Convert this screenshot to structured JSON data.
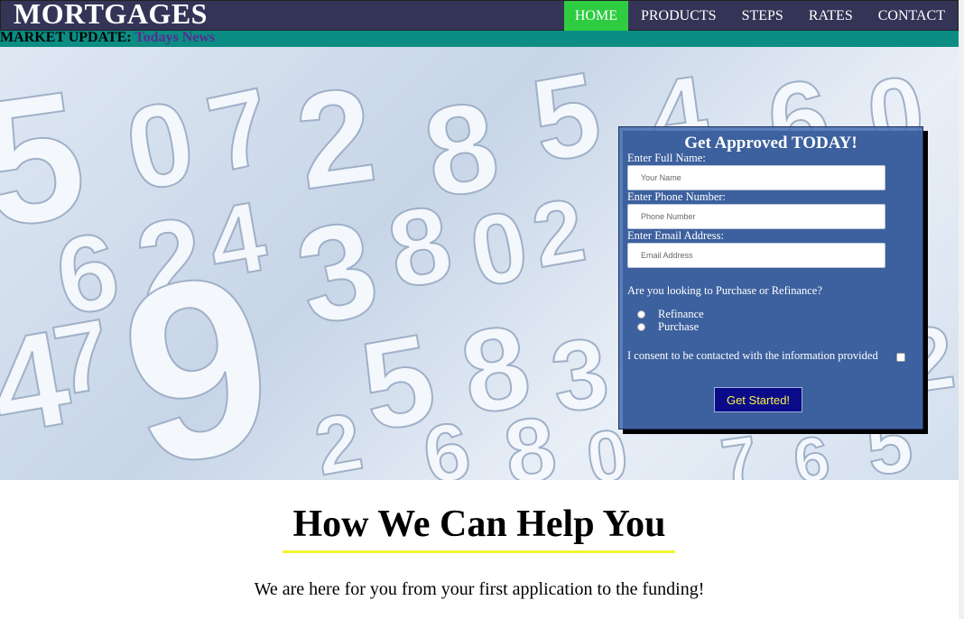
{
  "header": {
    "logo": "MORTGAGES",
    "nav": [
      {
        "label": "HOME",
        "active": true
      },
      {
        "label": "PRODUCTS",
        "active": false
      },
      {
        "label": "STEPS",
        "active": false
      },
      {
        "label": "RATES",
        "active": false
      },
      {
        "label": "CONTACT",
        "active": false
      }
    ]
  },
  "ticker": {
    "label": "MARKET UPDATE:",
    "link": "Todays News"
  },
  "form": {
    "title": "Get Approved TODAY!",
    "name_label": "Enter Full Name:",
    "name_placeholder": "Your Name",
    "phone_label": "Enter Phone Number:",
    "phone_placeholder": "Phone Number",
    "email_label": "Enter Email Address:",
    "email_placeholder": "Email Address",
    "question": "Are you looking to Purchase or Refinance?",
    "options": [
      "Refinance",
      "Purchase"
    ],
    "consent": "I consent to be contacted with the information provided",
    "submit": "Get Started!"
  },
  "content": {
    "title": "How We Can Help You",
    "text": "We are here for you from your first application to the funding!"
  },
  "colors": {
    "nav_bg": "#343457",
    "nav_active": "#2ecc40",
    "ticker_bg": "#0b8d83",
    "form_bg": "#466eb4",
    "button_bg": "#0b0b8a",
    "button_text": "#f6f34b",
    "underline": "#f4f433"
  }
}
